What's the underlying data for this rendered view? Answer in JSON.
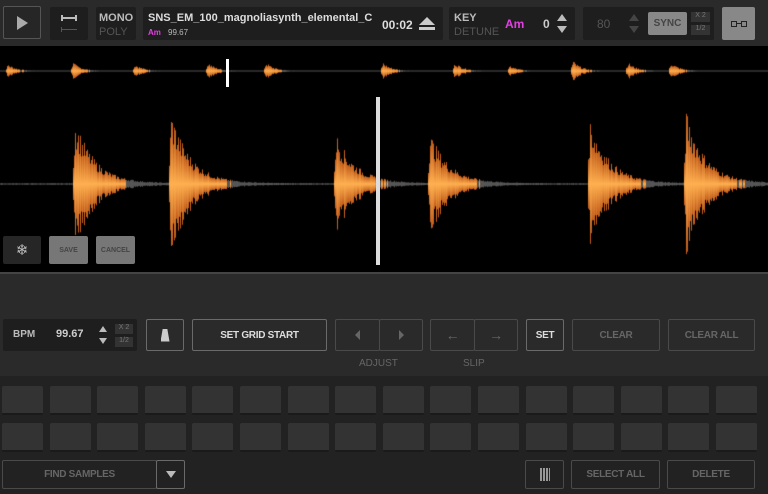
{
  "header": {
    "mono_label": "MONO",
    "poly_label": "POLY",
    "track_title": "SNS_EM_100_magnoliasynth_elemental_C",
    "track_key": "Am",
    "track_bpm": "99.67",
    "time": "00:02",
    "key_label": "KEY",
    "detune_label": "DETUNE",
    "key_value": "Am",
    "key_shift": "0",
    "tempo_value": "80",
    "sync_label": "SYNC",
    "x2_label": "X 2",
    "half_label": "1/2"
  },
  "waveform": {
    "save_label": "SAVE",
    "cancel_label": "CANCEL"
  },
  "grid": {
    "bpm_label": "BPM",
    "bpm_value": "99.67",
    "x2_label": "X 2",
    "half_label": "1/2",
    "set_grid_start": "SET GRID START",
    "adjust_label": "ADJUST",
    "slip_label": "SLIP",
    "set_label": "SET",
    "clear_label": "CLEAR",
    "clear_all_label": "CLEAR ALL"
  },
  "footer": {
    "find_samples": "FIND SAMPLES",
    "select_all": "SELECT ALL",
    "delete": "DELETE"
  },
  "colors": {
    "accent": "#e040e0",
    "wave": "#e8842a"
  }
}
